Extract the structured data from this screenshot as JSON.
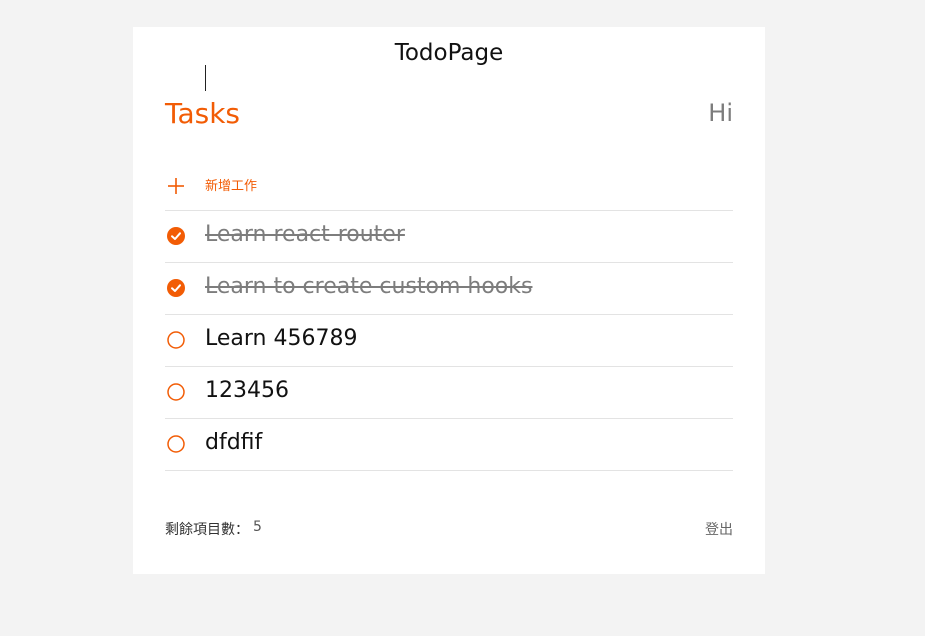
{
  "app": {
    "title": "TodoPage"
  },
  "header": {
    "heading": "Tasks",
    "greeting": "Hi"
  },
  "new_task": {
    "placeholder": "新增工作",
    "value": ""
  },
  "todos": [
    {
      "text": "Learn react-router",
      "done": true
    },
    {
      "text": "Learn to create custom hooks",
      "done": true
    },
    {
      "text": "Learn 456789",
      "done": false
    },
    {
      "text": "123456",
      "done": false
    },
    {
      "text": "dfdfif",
      "done": false
    }
  ],
  "footer": {
    "remaining_label": "剩餘項目數：",
    "remaining_count": "5",
    "logout_label": "登出"
  },
  "colors": {
    "accent": "#f25c05",
    "background": "#f3f3f3",
    "card": "#ffffff",
    "done_text": "#7d7d7d"
  },
  "icons": {
    "add": "plus-icon",
    "done": "check-circle-icon",
    "pending": "circle-outline-icon"
  }
}
